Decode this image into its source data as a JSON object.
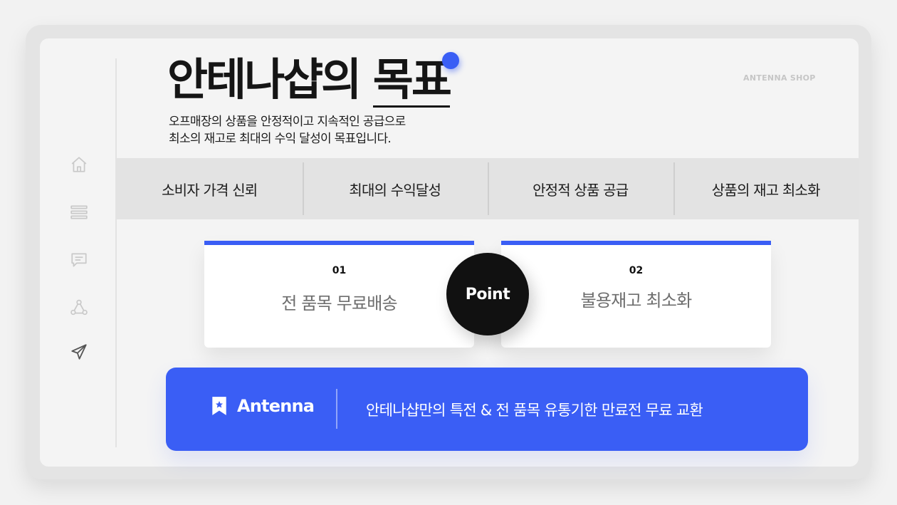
{
  "header": {
    "title_main": "안테나샵의 ",
    "title_emphasis": "목표",
    "brand_tag": "ANTENNA SHOP",
    "subtitle_lines": [
      "오프매장의 상품을 안정적이고 지속적인 공급으로",
      "최소의 재고로 최대의 수익 달성이 목표입니다."
    ]
  },
  "sidebar": {
    "items": [
      {
        "icon": "home-icon"
      },
      {
        "icon": "menu-icon"
      },
      {
        "icon": "message-icon"
      },
      {
        "icon": "share-icon"
      },
      {
        "icon": "send-icon"
      }
    ]
  },
  "tabs": [
    {
      "label": "소비자 가격 신뢰"
    },
    {
      "label": "최대의 수익달성"
    },
    {
      "label": "안정적 상품 공급"
    },
    {
      "label": "상품의 재고 최소화"
    }
  ],
  "points": {
    "badge_label": "Point",
    "cards": [
      {
        "number": "01",
        "text": "전 품목 무료배송"
      },
      {
        "number": "02",
        "text": "불용재고 최소화"
      }
    ]
  },
  "banner": {
    "brand": "Antenna",
    "logo_icon": "bookmark-star-icon",
    "text": "안테나샵만의 특전 & 전 품목 유통기한 만료전 무료 교환"
  },
  "colors": {
    "accent": "#3a5ef5",
    "badge": "#111111",
    "panel": "#f4f4f4",
    "tab_bar": "#e3e3e3"
  }
}
